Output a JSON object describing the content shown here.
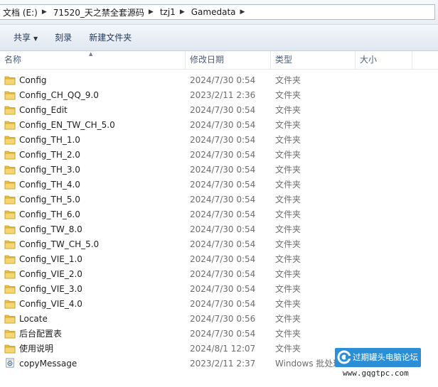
{
  "breadcrumb": [
    {
      "label": "文档 (E:)"
    },
    {
      "label": "71520_天之禁全套源码"
    },
    {
      "label": "tzj1"
    },
    {
      "label": "Gamedata"
    }
  ],
  "toolbar": {
    "share_label": "共享",
    "burn_label": "刻录",
    "new_folder_label": "新建文件夹"
  },
  "columns": {
    "name": "名称",
    "date": "修改日期",
    "type": "类型",
    "size": "大小"
  },
  "files": [
    {
      "name": "Config",
      "date": "2024/7/30 0:54",
      "type": "文件夹",
      "icon": "folder-icon"
    },
    {
      "name": "Config_CH_QQ_9.0",
      "date": "2023/2/11 2:36",
      "type": "文件夹",
      "icon": "folder-icon"
    },
    {
      "name": "Config_Edit",
      "date": "2024/7/30 0:54",
      "type": "文件夹",
      "icon": "folder-icon"
    },
    {
      "name": "Config_EN_TW_CH_5.0",
      "date": "2024/7/30 0:54",
      "type": "文件夹",
      "icon": "folder-icon"
    },
    {
      "name": "Config_TH_1.0",
      "date": "2024/7/30 0:54",
      "type": "文件夹",
      "icon": "folder-icon"
    },
    {
      "name": "Config_TH_2.0",
      "date": "2024/7/30 0:54",
      "type": "文件夹",
      "icon": "folder-icon"
    },
    {
      "name": "Config_TH_3.0",
      "date": "2024/7/30 0:54",
      "type": "文件夹",
      "icon": "folder-icon"
    },
    {
      "name": "Config_TH_4.0",
      "date": "2024/7/30 0:54",
      "type": "文件夹",
      "icon": "folder-icon"
    },
    {
      "name": "Config_TH_5.0",
      "date": "2024/7/30 0:54",
      "type": "文件夹",
      "icon": "folder-icon"
    },
    {
      "name": "Config_TH_6.0",
      "date": "2024/7/30 0:54",
      "type": "文件夹",
      "icon": "folder-icon"
    },
    {
      "name": "Config_TW_8.0",
      "date": "2024/7/30 0:54",
      "type": "文件夹",
      "icon": "folder-icon"
    },
    {
      "name": "Config_TW_CH_5.0",
      "date": "2024/7/30 0:54",
      "type": "文件夹",
      "icon": "folder-icon"
    },
    {
      "name": "Config_VIE_1.0",
      "date": "2024/7/30 0:54",
      "type": "文件夹",
      "icon": "folder-icon"
    },
    {
      "name": "Config_VIE_2.0",
      "date": "2024/7/30 0:54",
      "type": "文件夹",
      "icon": "folder-icon"
    },
    {
      "name": "Config_VIE_3.0",
      "date": "2024/7/30 0:54",
      "type": "文件夹",
      "icon": "folder-icon"
    },
    {
      "name": "Config_VIE_4.0",
      "date": "2024/7/30 0:54",
      "type": "文件夹",
      "icon": "folder-icon"
    },
    {
      "name": "Locate",
      "date": "2024/7/30 0:56",
      "type": "文件夹",
      "icon": "folder-icon"
    },
    {
      "name": "后台配置表",
      "date": "2024/7/30 0:54",
      "type": "文件夹",
      "icon": "folder-icon"
    },
    {
      "name": "使用说明",
      "date": "2024/8/1 12:07",
      "type": "文件夹",
      "icon": "folder-icon"
    },
    {
      "name": "copyMessage",
      "date": "2023/2/11 2:37",
      "type": "Windows 批处理",
      "icon": "batch-file-icon"
    }
  ],
  "watermark": {
    "text": "过期罐头电脑论坛",
    "url": "www.gqgtpc.com"
  },
  "colors": {
    "folder": "#e8c04a",
    "watermark_bg": "#2b8fd8",
    "header_text": "#4c607a",
    "toolbar_text": "#1e395b"
  }
}
